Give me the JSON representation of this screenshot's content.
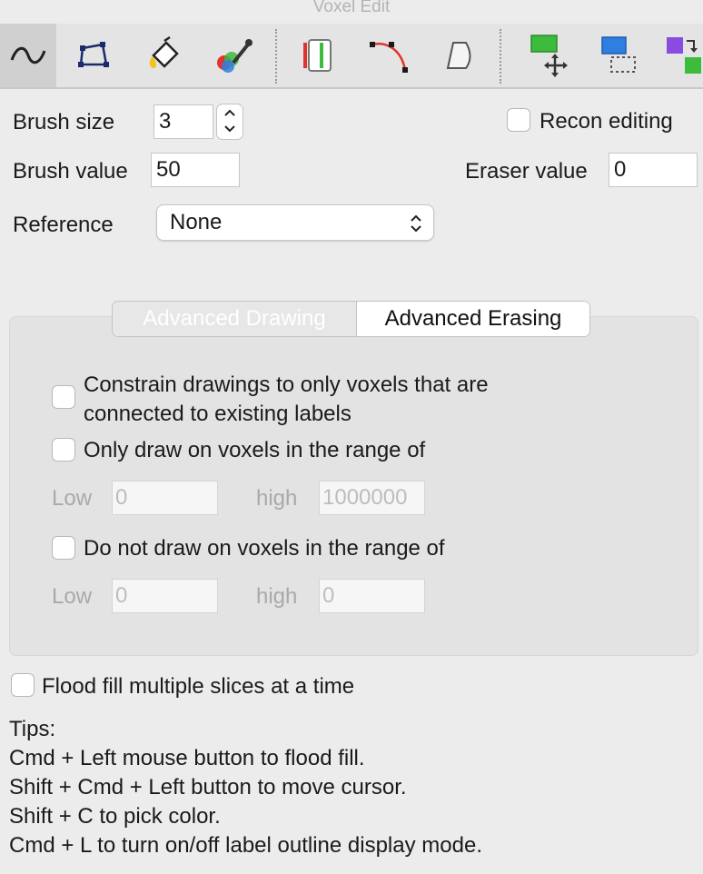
{
  "window": {
    "title": "Voxel Edit"
  },
  "toolbar": {
    "tools": [
      {
        "name": "freehand-draw-tool",
        "icon": "wave-icon"
      },
      {
        "name": "polygon-tool",
        "icon": "polygon-icon"
      },
      {
        "name": "flood-fill-tool",
        "icon": "paint-bucket-icon"
      },
      {
        "name": "color-picker-tool",
        "icon": "eyedropper-icon"
      },
      {
        "name": "slice-tool",
        "icon": "slice-bars-icon"
      },
      {
        "name": "curve-tool",
        "icon": "curve-icon"
      },
      {
        "name": "shape-tool",
        "icon": "shape-icon"
      },
      {
        "name": "move-tool",
        "icon": "move-arrows-icon"
      },
      {
        "name": "select-region-tool",
        "icon": "selection-icon"
      },
      {
        "name": "copy-label-tool",
        "icon": "copy-squares-icon"
      }
    ],
    "colors": {
      "active_bg": "#d0d0d0",
      "red": "#e0342c",
      "green": "#3cbb3c",
      "blue": "#2f7fe0",
      "purple": "#8a4be0"
    }
  },
  "brush": {
    "size_label": "Brush size",
    "size_value": "3",
    "value_label": "Brush value",
    "value_value": "50"
  },
  "recon": {
    "label": "Recon editing",
    "checked": false
  },
  "eraser": {
    "label": "Eraser value",
    "value": "0"
  },
  "reference": {
    "label": "Reference",
    "selected": "None"
  },
  "tabs": [
    {
      "label": "Advanced Drawing",
      "selected": true
    },
    {
      "label": "Advanced Erasing",
      "selected": false
    }
  ],
  "advanced": {
    "constrain_label": "Constrain drawings to only voxels that are connected to existing labels",
    "constrain_line1": "Constrain drawings to only voxels that are",
    "constrain_line2": "connected to existing labels",
    "only_draw": {
      "label": "Only draw on voxels in the range of",
      "low_label": "Low",
      "low_value": "0",
      "high_label": "high",
      "high_value": "1000000"
    },
    "not_draw": {
      "label": "Do not draw on voxels in the range of",
      "low_label": "Low",
      "low_value": "0",
      "high_label": "high",
      "high_value": "0"
    }
  },
  "flood": {
    "label": "Flood fill multiple slices at a time"
  },
  "tips": {
    "title": "Tips:",
    "lines": [
      "Cmd + Left mouse button to flood fill.",
      "Shift + Cmd + Left button to move cursor.",
      "Shift + C to pick color.",
      "Cmd + L to turn on/off label outline display mode."
    ]
  }
}
